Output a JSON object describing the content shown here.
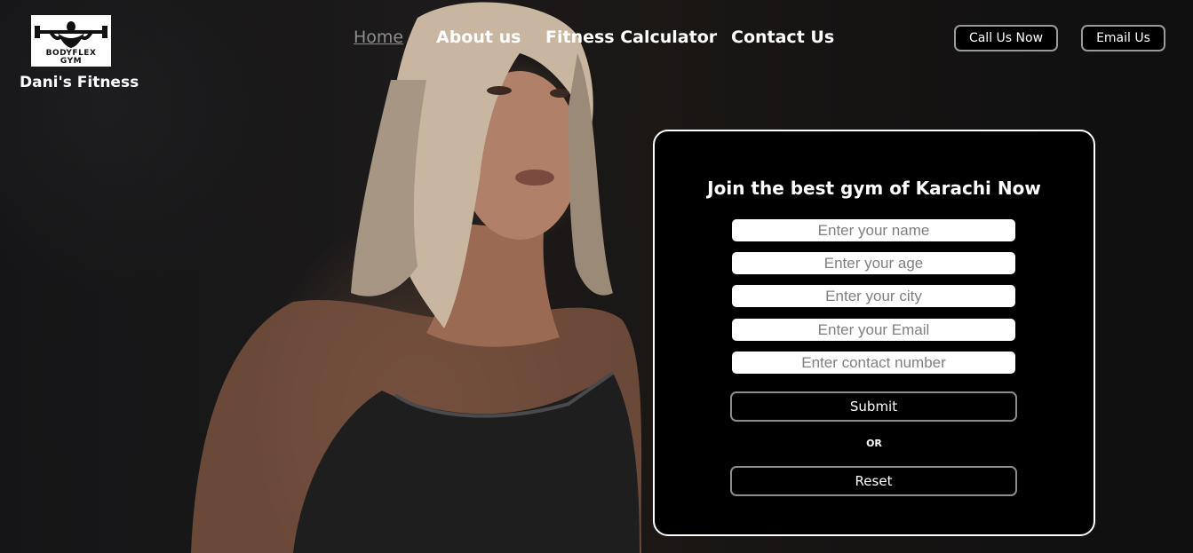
{
  "brand": {
    "logo_line1": "BODYFLEX",
    "logo_line2": "GYM",
    "name": "Dani's Fitness"
  },
  "nav": {
    "items": [
      {
        "label": "Home",
        "active": true
      },
      {
        "label": "About us",
        "active": false
      },
      {
        "label": "Fitness Calculator",
        "active": false
      },
      {
        "label": "Contact Us",
        "active": false
      }
    ]
  },
  "header_buttons": {
    "call": "Call Us Now",
    "email": "Email Us"
  },
  "form": {
    "title": "Join the best gym of Karachi Now",
    "fields": [
      {
        "placeholder": "Enter your name",
        "value": ""
      },
      {
        "placeholder": "Enter your age",
        "value": ""
      },
      {
        "placeholder": "Enter your city",
        "value": ""
      },
      {
        "placeholder": "Enter your Email",
        "value": ""
      },
      {
        "placeholder": "Enter contact number",
        "value": ""
      }
    ],
    "submit_label": "Submit",
    "or_label": "OR",
    "reset_label": "Reset"
  },
  "colors": {
    "background": "#121214",
    "card_background": "#000000",
    "card_border": "#ffffff",
    "nav_active": "#8e8e8e",
    "button_border": "#8c8c8c"
  },
  "icons": {
    "logo": "bodybuilder-logo-icon",
    "hero": "hero-woman-image"
  }
}
